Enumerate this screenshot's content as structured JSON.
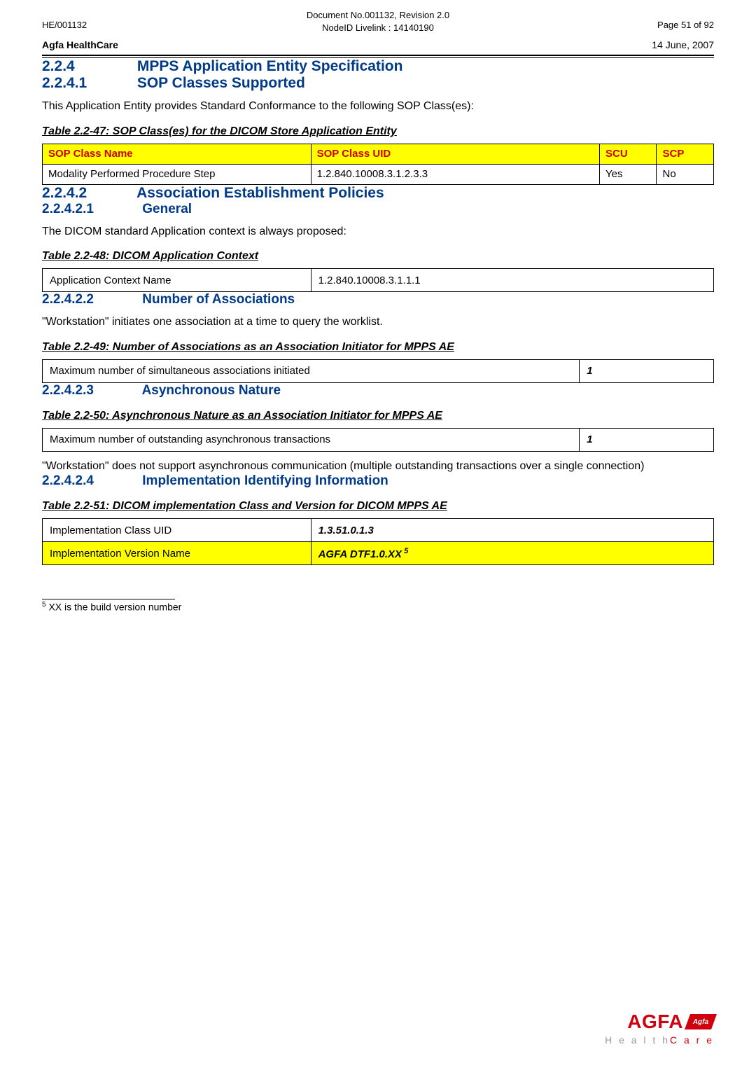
{
  "header": {
    "doc_code": "HE/001132",
    "page_info": "Page 51 of 92",
    "doc_no": "Document No.001132, Revision 2.0",
    "node_id": "NodeID Livelink : 14140190",
    "company": "Agfa HealthCare",
    "date": "14 June, 2007"
  },
  "sections": {
    "s224": {
      "num": "2.2.4",
      "title": "MPPS Application Entity Specification"
    },
    "s2241": {
      "num": "2.2.4.1",
      "title": "SOP Classes Supported"
    },
    "s2242": {
      "num": "2.2.4.2",
      "title": "Association Establishment Policies"
    },
    "s22421": {
      "num": "2.2.4.2.1",
      "title": "General"
    },
    "s22422": {
      "num": "2.2.4.2.2",
      "title": "Number of Associations"
    },
    "s22423": {
      "num": "2.2.4.2.3",
      "title": "Asynchronous Nature"
    },
    "s22424": {
      "num": "2.2.4.2.4",
      "title": "Implementation Identifying Information"
    }
  },
  "text": {
    "p_2241": "This Application Entity provides Standard Conformance to the following SOP Class(es):",
    "p_22421": "The DICOM standard Application context is always proposed:",
    "p_22422": "\"Workstation\" initiates one association at a time to query the worklist.",
    "p_22423_after": "\"Workstation\" does not support asynchronous communication (multiple outstanding transactions over a single connection)"
  },
  "captions": {
    "t47": "Table 2.2-47: SOP Class(es) for the DICOM Store Application Entity",
    "t48": "Table 2.2-48: DICOM Application Context",
    "t49": "Table 2.2-49: Number of Associations as an Association Initiator for MPPS AE",
    "t50": "Table 2.2-50: Asynchronous Nature as an Association Initiator for MPPS AE",
    "t51": "Table 2.2-51: DICOM implementation Class and Version for DICOM MPPS AE"
  },
  "table47": {
    "headers": {
      "name": "SOP Class Name",
      "uid": "SOP Class UID",
      "scu": "SCU",
      "scp": "SCP"
    },
    "row": {
      "name": "Modality Performed Procedure Step",
      "uid": "1.2.840.10008.3.1.2.3.3",
      "scu": "Yes",
      "scp": "No"
    }
  },
  "table48": {
    "label": "Application Context Name",
    "value": "1.2.840.10008.3.1.1.1"
  },
  "table49": {
    "label": "Maximum number of simultaneous associations initiated",
    "value": "1"
  },
  "table50": {
    "label": "Maximum number of outstanding asynchronous transactions",
    "value": "1"
  },
  "table51": {
    "row1": {
      "label": "Implementation Class UID",
      "value": "1.3.51.0.1.3"
    },
    "row2": {
      "label": "Implementation Version Name",
      "value_prefix": "AGFA DTF1.0.XX",
      "value_suffix": " 5"
    }
  },
  "footnote": {
    "marker": "5",
    "text": " XX is the build version number"
  },
  "logo": {
    "brand": "AGFA",
    "badge": "Agfa",
    "sub1": "H e a l t h",
    "sub2": "C a r e"
  }
}
